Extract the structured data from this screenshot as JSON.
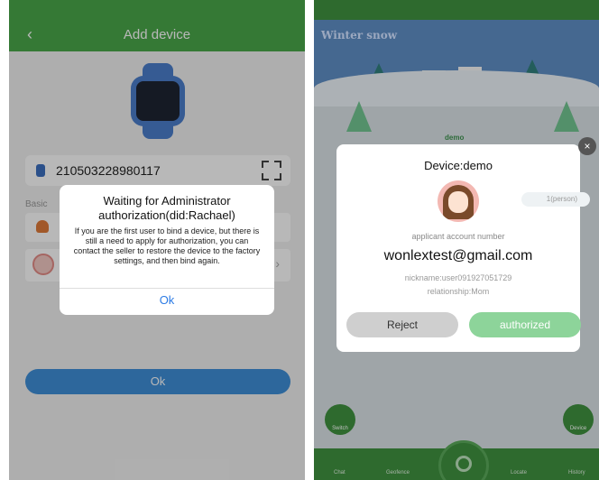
{
  "left_screen": {
    "header": {
      "back_icon": "chevron-left-icon",
      "title": "Add device"
    },
    "device_id": "210503228980117",
    "section_label": "Basic",
    "bind_button": "Ok",
    "dialog": {
      "title": "Waiting for Administrator authorization(did:Rachael)",
      "message": "If you are the first user to bind a device, but there is still a need to apply for authorization, you can contact the seller to restore the device to the factory settings, and then bind again.",
      "ok": "Ok"
    }
  },
  "right_screen": {
    "banner_title": "Winter snow",
    "device_name_bg": "demo",
    "dialog": {
      "title": "Device:demo",
      "member_count": "1(person)",
      "applicant_label": "applicant account number",
      "email": "wonlextest@gmail.com",
      "nickname": "nickname:user091927051729",
      "relationship": "relationship:Mom",
      "reject": "Reject",
      "authorize": "authorized"
    },
    "side_buttons": {
      "switch": "Switch",
      "device": "Device"
    },
    "bottom_nav": [
      "Chat",
      "Geofence",
      "Locate",
      "History"
    ],
    "colors": {
      "brand_green": "#3e8e3e",
      "authorize_green": "#8dd49a",
      "link_blue": "#2c7be5"
    }
  }
}
